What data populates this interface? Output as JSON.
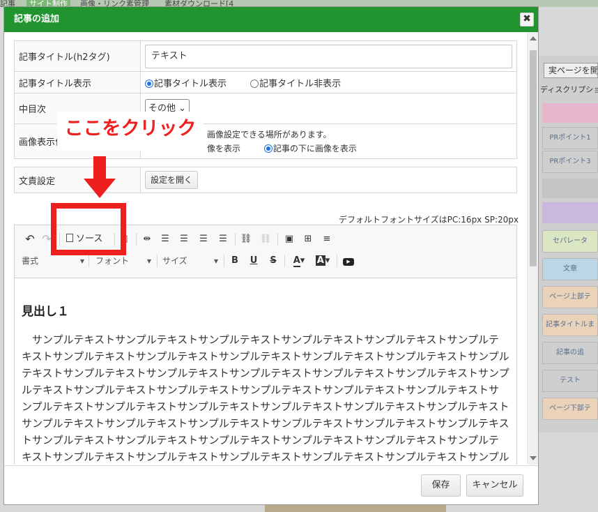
{
  "background": {
    "top_items": [
      "記事",
      "サイト制作",
      "画像・リンク素管理",
      "素材ダウンロード[4"
    ],
    "real_page_button": "実ページを開",
    "description_label": "ディスクリプション",
    "side_items": [
      "PRポイント1",
      "PRポイント3",
      "セパレータ",
      "文章",
      "ページ上部テ",
      "記事タイトルま",
      "記事の追",
      "テスト",
      "ページ下部テ"
    ]
  },
  "modal": {
    "title": "記事の追加",
    "close_glyph": "✖",
    "form": {
      "article_title_label": "記事タイトル(h2タグ)",
      "article_title_value": "テキスト",
      "title_display_label": "記事タイトル表示",
      "title_display_options": [
        "記事タイトル表示",
        "記事タイトル非表示"
      ],
      "toc_label": "中目次",
      "toc_value": "その他",
      "image_display_label": "画像表示位",
      "image_note": "画像設定できる場所があります。",
      "image_option_partial": "像を表示",
      "image_option_below": "記事の下に画像を表示",
      "paragraph_label": "文責設定",
      "paragraph_button": "設定を開く"
    },
    "editor": {
      "font_note": "デフォルトフォントサイズはPC:16px SP:20px",
      "source_label": "ソース",
      "format_label": "書式",
      "font_label": "フォント",
      "size_label": "サイズ",
      "heading": "見出し１",
      "body": "サンプルテキストサンプルテキストサンプルテキストサンプルテキストサンプルテキストサンプルテキストサンプルテキストサンプルテキストサンプルテキストサンプルテキストサンプルテキストサンプルテキストサンプルテキストサンプルテキストサンプルテキストサンプルテキストサンプルテキストサンプルテキストサンプルテキストサンプルテキストサンプルテキストサンプルテキストサンプルテキストサンプルテキストサンプルテキストサンプルテキストサンプルテキストサンプルテキストサンプルテキストサンプルテキストサンプルテキストサンプルテキストサンプルテキストサンプルテキストサンプルテキストサンプルテキストサンプルテキストサンプルテキストサンプルテキストサンプルテキストサンプルテキストサンプルテキストサンプルテキストサンプルテキストサンプルテキストサンプルテキストサンプルテキストサンプルテキストサンプルテキスト"
    },
    "footer": {
      "save": "保存",
      "cancel": "キャンセル"
    }
  },
  "annotation": {
    "text": "ここをクリック",
    "color": "#ee1f1f"
  },
  "colors": {
    "header": "#22942f",
    "accent": "#1a73e8"
  }
}
